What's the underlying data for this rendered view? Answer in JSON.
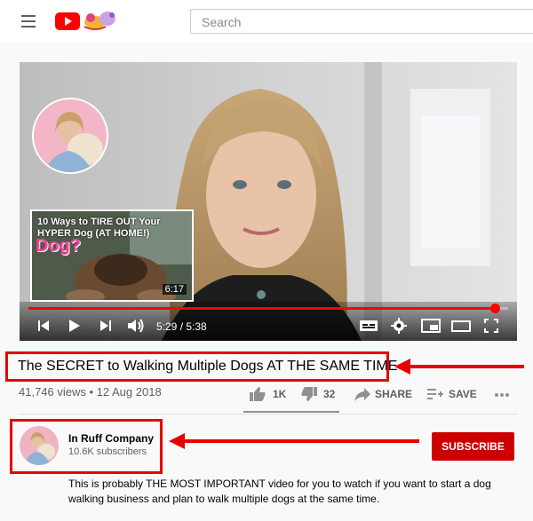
{
  "header": {
    "search_placeholder": "Search"
  },
  "player": {
    "current_time": "5:29",
    "duration": "5:38",
    "time_display": "5:29 / 5:38",
    "progress": 0.973,
    "endcard": {
      "title": "10 Ways to TIRE OUT Your HYPER Dog (AT HOME!)",
      "overlay_text": "Dog?",
      "duration": "6:17"
    }
  },
  "video": {
    "title": "The SECRET to Walking Multiple Dogs AT THE SAME TIME",
    "views": "41,746 views",
    "date": "12 Aug 2018",
    "meta_line": "41,746 views • 12 Aug 2018"
  },
  "actions": {
    "likes": "1K",
    "dislikes": "32",
    "share": "SHARE",
    "save": "SAVE"
  },
  "channel": {
    "name": "In Ruff Company",
    "subscribers": "10.6K subscribers",
    "subscribe_label": "SUBSCRIBE"
  },
  "description": "This is probably THE MOST IMPORTANT video for you to watch if you want to start a dog walking business and plan to walk multiple dogs at the same time.",
  "colors": {
    "accent_red": "#cc0000",
    "annotation_red": "#e60000",
    "progress_red": "#ff0000"
  }
}
